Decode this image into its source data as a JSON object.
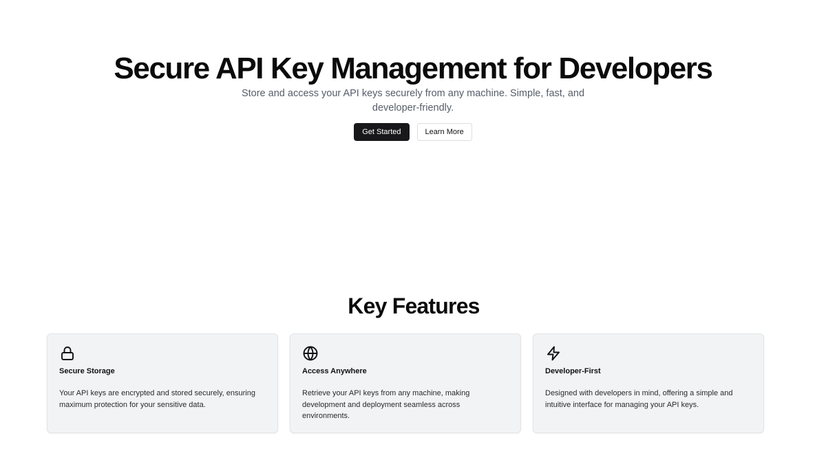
{
  "hero": {
    "title": "Secure API Key Management for Developers",
    "subtitle": "Store and access your API keys securely from any machine. Simple, fast, and developer-friendly.",
    "primary_button": "Get Started",
    "secondary_button": "Learn More"
  },
  "features": {
    "title": "Key Features",
    "items": [
      {
        "icon": "lock-icon",
        "title": "Secure Storage",
        "description": "Your API keys are encrypted and stored securely, ensuring maximum protection for your sensitive data."
      },
      {
        "icon": "globe-icon",
        "title": "Access Anywhere",
        "description": "Retrieve your API keys from any machine, making development and deployment seamless across environments."
      },
      {
        "icon": "lightning-icon",
        "title": "Developer-First",
        "description": "Designed with developers in mind, offering a simple and intuitive interface for managing your API keys."
      }
    ]
  },
  "colors": {
    "background": "#ffffff",
    "primary_button": "#18181b",
    "card_background": "#f2f3f5",
    "subtitle_text": "#565d69"
  }
}
